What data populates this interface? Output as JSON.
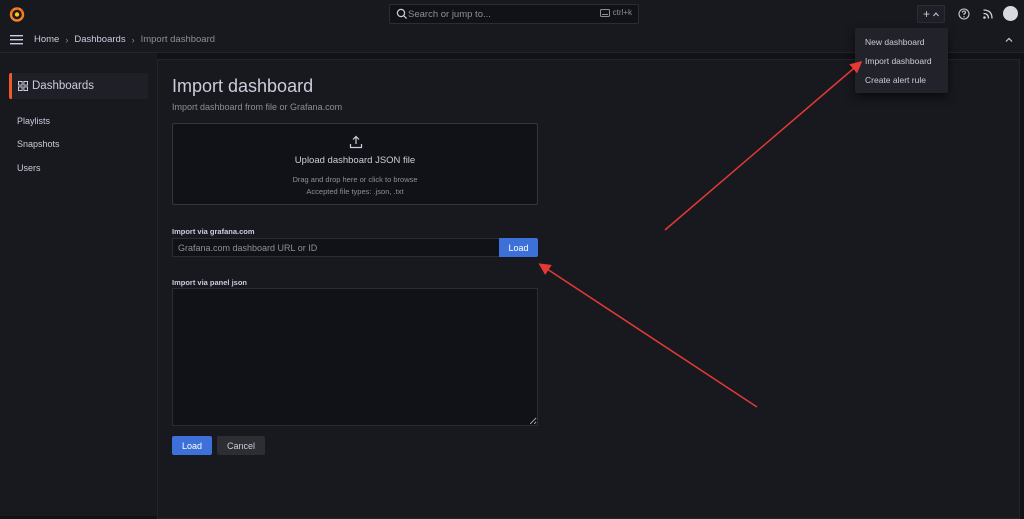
{
  "topbar": {
    "search_placeholder": "Search or jump to...",
    "search_shortcut": "ctrl+k",
    "plus_label": "+"
  },
  "breadcrumb": {
    "home": "Home",
    "dashboards": "Dashboards",
    "current": "Import dashboard"
  },
  "sidebar": {
    "header": "Dashboards",
    "items": [
      {
        "label": "Playlists"
      },
      {
        "label": "Snapshots"
      },
      {
        "label": "Users"
      }
    ]
  },
  "page": {
    "title": "Import dashboard",
    "subtitle": "Import dashboard from file or Grafana.com"
  },
  "upload": {
    "heading": "Upload dashboard JSON file",
    "hint": "Drag and drop here or click to browse",
    "accepted": "Accepted file types: .json, .txt"
  },
  "grafana_import": {
    "label": "Import via grafana.com",
    "placeholder": "Grafana.com dashboard URL or ID",
    "load_label": "Load"
  },
  "panel_json": {
    "label": "Import via panel json",
    "value": ""
  },
  "actions": {
    "load": "Load",
    "cancel": "Cancel"
  },
  "dropdown": {
    "items": [
      {
        "label": "New dashboard"
      },
      {
        "label": "Import dashboard"
      },
      {
        "label": "Create alert rule"
      }
    ]
  },
  "colors": {
    "background": "#111217",
    "panel": "#18181f",
    "primary": "#3d71d9",
    "accent": "#f05a28",
    "annotation": "#e53935"
  }
}
